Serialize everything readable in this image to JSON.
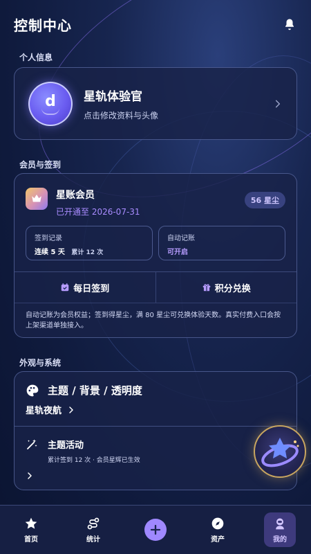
{
  "header": {
    "title": "控制中心",
    "bell_icon": "bell-icon"
  },
  "sections": {
    "profile": "个人信息",
    "membership": "会员与签到",
    "appearance": "外观与系统"
  },
  "profile": {
    "avatar_letter": "d",
    "name": "星轨体验官",
    "subtitle": "点击修改资料与头像"
  },
  "membership": {
    "title": "星账会员",
    "status": "已开通至 2026-07-31",
    "stardust": "56 星尘",
    "checkin": {
      "title": "签到记录",
      "streak": "连续 5 天",
      "total": "累计 12 次"
    },
    "auto": {
      "title": "自动记账",
      "status": "可开启"
    },
    "daily_checkin": "每日签到",
    "points_exchange": "积分兑换",
    "note": "自动记账为会员权益；签到得星尘，满 80 星尘可兑换体验天数。真实付费入口会按上架渠道单独接入。"
  },
  "appearance": {
    "theme_label": "主题 / 背景 / 透明度",
    "theme_value": "星轨夜航",
    "event_title": "主题活动",
    "event_sub": "累计签到 12 次 · 会员星辉已生效"
  },
  "nav": {
    "items": [
      {
        "label": "首页",
        "icon": "star-icon"
      },
      {
        "label": "统计",
        "icon": "chart-route-icon"
      },
      {
        "label": "",
        "icon": "plus-icon"
      },
      {
        "label": "资产",
        "icon": "compass-icon"
      },
      {
        "label": "我的",
        "icon": "astronaut-icon"
      }
    ]
  },
  "colors": {
    "accent": "#9f88ff",
    "background": "#0f1a3c",
    "card": "#182248"
  }
}
